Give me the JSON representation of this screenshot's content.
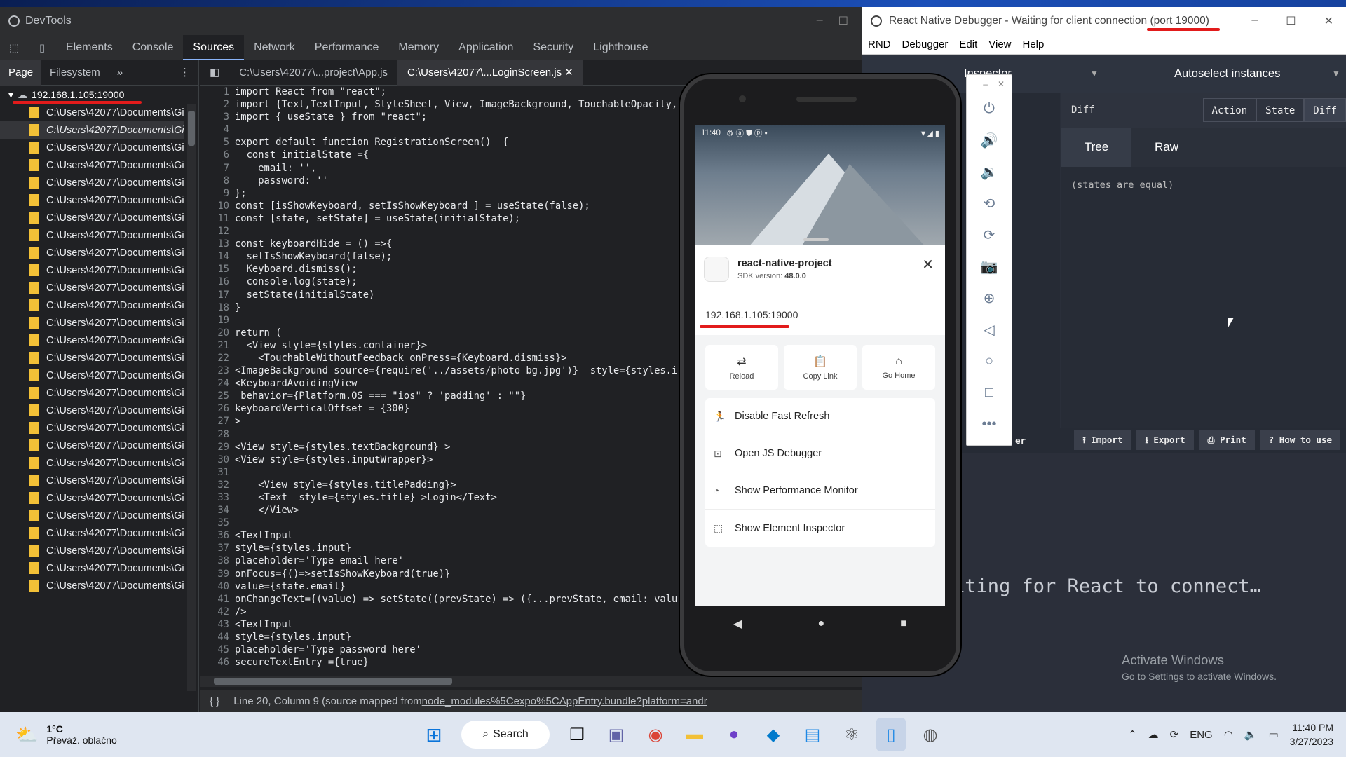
{
  "devtools": {
    "title": "DevTools",
    "tabs": [
      "Elements",
      "Console",
      "Sources",
      "Network",
      "Performance",
      "Memory",
      "Application",
      "Security",
      "Lighthouse"
    ],
    "active_tab": "Sources",
    "nav_tabs": [
      "Page",
      "Filesystem"
    ],
    "root_host": "192.168.1.105:19000",
    "file_label": "C:\\Users\\42077\\Documents\\Gi",
    "editor_tabs": [
      "C:\\Users\\42077\\...project\\App.js",
      "C:\\Users\\42077\\...LoginScreen.js"
    ],
    "status": "Line 20, Column 9  (source mapped from ",
    "status_link": "node_modules%5Cexpo%5CAppEntry.bundle?platform=andr"
  },
  "code": [
    "import React from \"react\";",
    "import {Text,TextInput, StyleSheet, View, ImageBackground, TouchableOpacity,",
    "import { useState } from \"react\";",
    "",
    "export default function RegistrationScreen()  {",
    "  const initialState ={",
    "    email: '',",
    "    password: ''",
    "};",
    "const [isShowKeyboard, setIsShowKeyboard ] = useState(false);",
    "const [state, setState] = useState(initialState);",
    "",
    "const keyboardHide = () =>{",
    "  setIsShowKeyboard(false);",
    "  Keyboard.dismiss();",
    "  console.log(state);",
    "  setState(initialState)",
    "}",
    "",
    "return (",
    "  <View style={styles.container}>",
    "    <TouchableWithoutFeedback onPress={Keyboard.dismiss}>",
    "<ImageBackground source={require('../assets/photo_bg.jpg')}  style={styles.i",
    "<KeyboardAvoidingView",
    " behavior={Platform.OS === \"ios\" ? 'padding' : \"\"}",
    "keyboardVerticalOffset = {300}",
    ">",
    "",
    "<View style={styles.textBackground} >",
    "<View style={styles.inputWrapper}>",
    "",
    "    <View style={styles.titlePadding}>",
    "    <Text  style={styles.title} >Login</Text>",
    "    </View>",
    "",
    "<TextInput",
    "style={styles.input}",
    "placeholder='Type email here'",
    "onFocus={()=>setIsShowKeyboard(true)}",
    "value={state.email}",
    "onChangeText={(value) => setState((prevState) => ({...prevState, email: valu",
    "/>",
    "<TextInput",
    "style={styles.input}",
    "placeholder='Type password here'",
    "secureTextEntry ={true}"
  ],
  "rnd": {
    "title": "React Native Debugger - Waiting for client connection (port 19000)",
    "menu": [
      "RND",
      "Debugger",
      "Edit",
      "View",
      "Help"
    ],
    "inspector": "Inspector",
    "autoselect": "Autoselect instances",
    "diff_label": "Diff",
    "diff_buttons": [
      "Action",
      "State",
      "Diff"
    ],
    "tree_tabs": [
      "Tree",
      "Raw"
    ],
    "states_text": "(states are equal)",
    "actions": [
      "Import",
      "Export",
      "Print",
      "How to use"
    ],
    "actions_partial": "er",
    "waiting": "iting for React to connect…",
    "activate_title": "Activate Windows",
    "activate_sub": "Go to Settings to activate Windows."
  },
  "phone": {
    "time": "11:40",
    "app_name": "react-native-project",
    "sdk_label": "SDK version: ",
    "sdk_version": "48.0.0",
    "url": "192.168.1.105:19000",
    "quick": [
      {
        "icon": "reload-icon",
        "label": "Reload"
      },
      {
        "icon": "copy-link-icon",
        "label": "Copy Link"
      },
      {
        "icon": "home-icon",
        "label": "Go Home"
      }
    ],
    "menu": [
      {
        "icon": "run-icon",
        "label": "Disable Fast Refresh"
      },
      {
        "icon": "debugger-icon",
        "label": "Open JS Debugger"
      },
      {
        "icon": "gauge-icon",
        "label": "Show Performance Monitor"
      },
      {
        "icon": "inspector-icon",
        "label": "Show Element Inspector"
      }
    ]
  },
  "taskbar": {
    "temp": "1°C",
    "weather": "Převáž. oblačno",
    "search": "Search",
    "lang": "ENG",
    "time": "11:40 PM",
    "date": "3/27/2023"
  }
}
